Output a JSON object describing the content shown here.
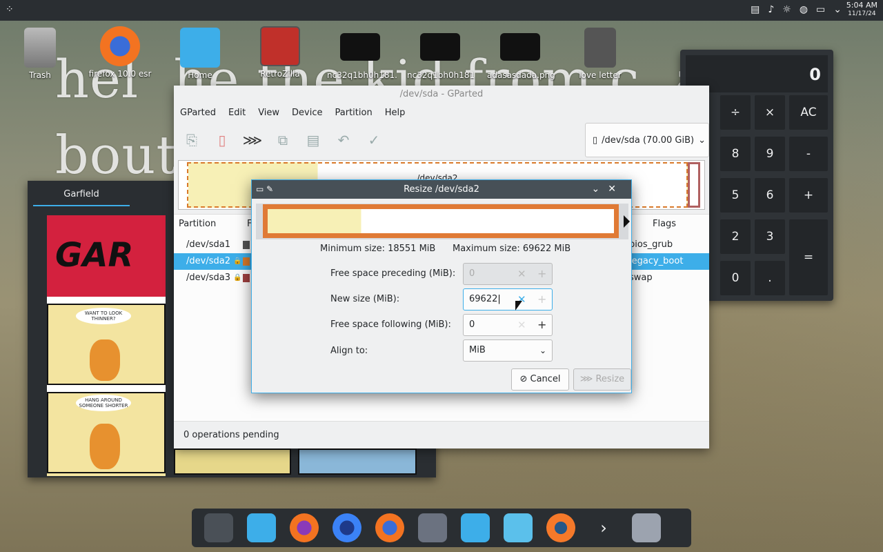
{
  "desktop": {
    "bg_text_1": "hel  he the kid from c  a",
    "bg_text_2": "bout",
    "icons": [
      {
        "label": "Trash"
      },
      {
        "label": "firefox 10.0 esr"
      },
      {
        "label": "Home"
      },
      {
        "label": "RetroZilla"
      },
      {
        "label": "nc32q1bh0h181."
      },
      {
        "label": "nc32q1bh0h181"
      },
      {
        "label": "adasasdada.png"
      },
      {
        "label": "love letter"
      }
    ]
  },
  "top_panel": {
    "clock_time": "5:04 AM",
    "clock_date": "11/17/24"
  },
  "calculator": {
    "display": "0",
    "buttons": [
      "÷",
      "×",
      "AC",
      "8",
      "9",
      "-",
      "5",
      "6",
      "+",
      "2",
      "3",
      "=",
      "0",
      ".",
      ""
    ]
  },
  "garfield": {
    "tab": "Garfield",
    "comic_banner": "GAR",
    "bubble1": "WANT TO LOOK THINNER?",
    "bubble2": "HANG AROUND SOMEONE SHORTER"
  },
  "gparted": {
    "title": "/dev/sda - GParted",
    "menu": [
      "GParted",
      "Edit",
      "View",
      "Device",
      "Partition",
      "Help"
    ],
    "device": "/dev/sda (70.00 GiB)",
    "graph_label": "/dev/sda2",
    "columns": {
      "partition": "Partition",
      "flags": "Flags",
      "fs": "F"
    },
    "rows": [
      {
        "name": "/dev/sda1",
        "flags": "bios_grub"
      },
      {
        "name": "/dev/sda2",
        "flags": "legacy_boot"
      },
      {
        "name": "/dev/sda3",
        "flags": "swap"
      }
    ],
    "status": "0 operations pending"
  },
  "resize_dialog": {
    "title": "Resize /dev/sda2",
    "min_size": "Minimum size: 18551 MiB",
    "max_size": "Maximum size: 69622 MiB",
    "labels": {
      "preceding": "Free space preceding (MiB):",
      "new_size": "New size (MiB):",
      "following": "Free space following (MiB):",
      "align": "Align to:"
    },
    "values": {
      "preceding": "0",
      "new_size": "69622",
      "following": "0",
      "align": "MiB"
    },
    "used_fraction": 0.27,
    "cancel": "Cancel",
    "resize": "Resize"
  }
}
